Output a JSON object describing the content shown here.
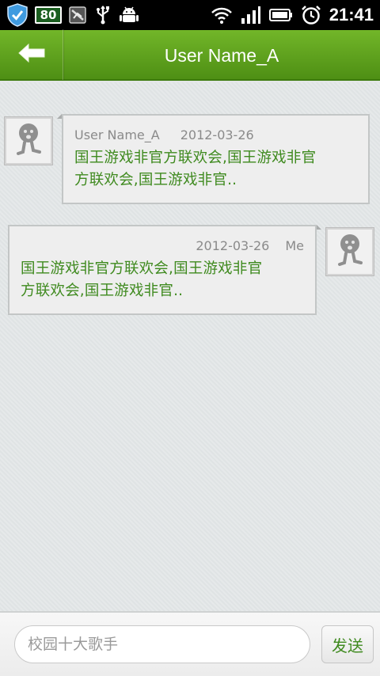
{
  "status_bar": {
    "battery_percent": "80",
    "time": "21:41",
    "icons": [
      "shield-icon",
      "battery-badge",
      "no-sim-icon",
      "usb-icon",
      "android-icon",
      "wifi-icon",
      "signal-icon",
      "battery-icon",
      "alarm-icon"
    ]
  },
  "header": {
    "title": "User Name_A",
    "back_icon": "back-arrow-icon"
  },
  "messages": [
    {
      "sender": "User Name_A",
      "date": "2012-03-26",
      "text": "国王游戏非官方联欢会,国王游戏非官方联欢会,国王游戏非官..",
      "line1": "国王游戏非官方联欢会,国王游戏非官",
      "line2": "方联欢会,国王游戏非官.."
    },
    {
      "sender": "Me",
      "date": "2012-03-26",
      "text": "国王游戏非官方联欢会,国王游戏非官方联欢会,国王游戏非官..",
      "line1": "国王游戏非官方联欢会,国王游戏非官",
      "line2": "方联欢会,国王游戏非官.."
    }
  ],
  "composer": {
    "placeholder": "校园十大歌手",
    "send_label": "发送"
  },
  "colors": {
    "accent_green": "#5a9e1c",
    "message_text": "#3f8a1f"
  }
}
